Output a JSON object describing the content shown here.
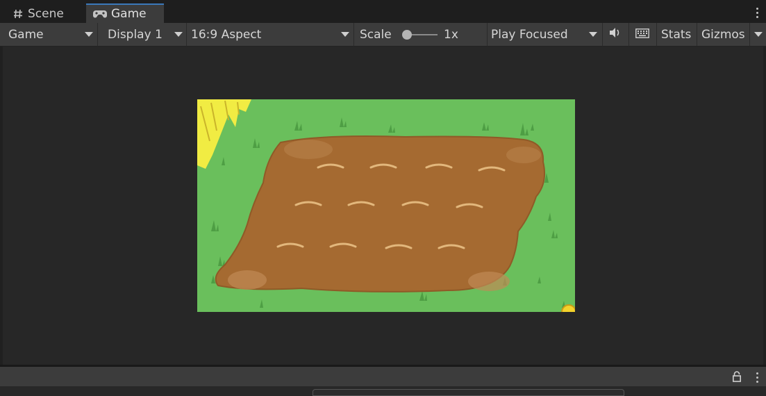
{
  "tabs": {
    "scene": {
      "label": "Scene",
      "icon": "hash-icon"
    },
    "game": {
      "label": "Game",
      "icon": "gamepad-icon"
    }
  },
  "toolbar": {
    "view_dropdown": "Game",
    "display_dropdown": "Display 1",
    "aspect_dropdown": "16:9 Aspect",
    "scale_label": "Scale",
    "scale_value": "1x",
    "play_mode_dropdown": "Play Focused",
    "stats_label": "Stats",
    "gizmos_label": "Gizmos"
  },
  "game_view": {
    "scene": "Plowed farm field on grass",
    "furrow_rows": 3,
    "furrows_per_row": 4,
    "colors": {
      "grass": "#6abf5c",
      "soil": "#a56a31",
      "hay": "#f1ec43",
      "furrow": "#e2b77c"
    }
  },
  "status": {
    "lock_icon": "lock-icon"
  },
  "theme": {
    "accent": "#3a79bb",
    "panel": "#3c3c3c",
    "background": "#282828"
  }
}
